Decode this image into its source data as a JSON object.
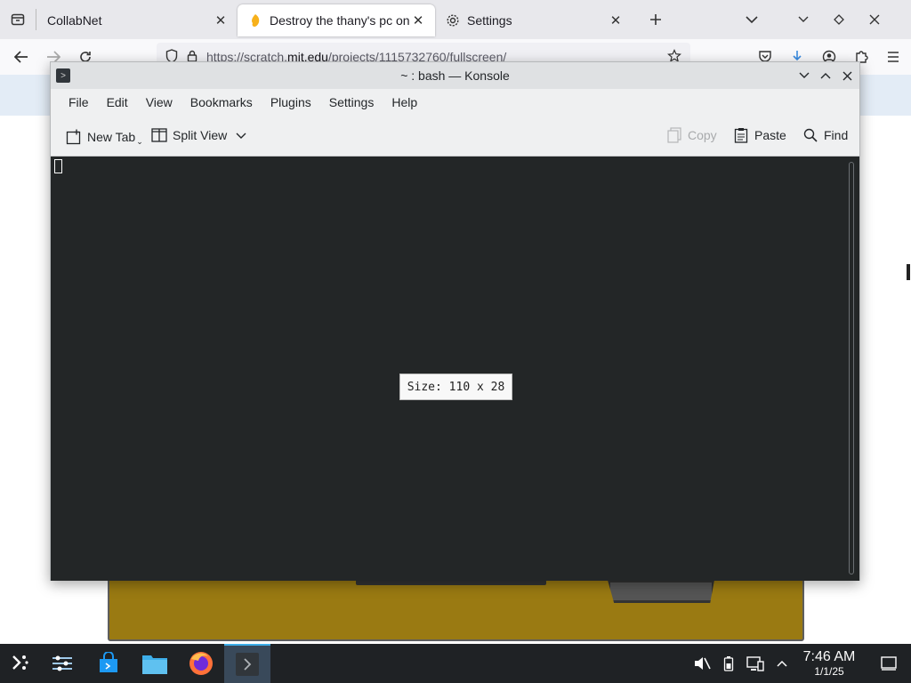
{
  "browser": {
    "tabs": [
      {
        "label": "CollabNet",
        "active": false
      },
      {
        "label": "Destroy the thany's pc on :",
        "active": true
      },
      {
        "label": "Settings",
        "active": false
      }
    ],
    "url_prefix": "https://scratch.",
    "url_domain": "mit.edu",
    "url_suffix": "/projects/1115732760/fullscreen/"
  },
  "konsole": {
    "title": "~ : bash — Konsole",
    "menu": [
      "File",
      "Edit",
      "View",
      "Bookmarks",
      "Plugins",
      "Settings",
      "Help"
    ],
    "toolbar": {
      "new_tab": "New Tab",
      "split_view": "Split View",
      "copy": "Copy",
      "paste": "Paste",
      "find": "Find"
    },
    "size_tooltip": "Size: 110 x 28"
  },
  "taskbar": {
    "time": "7:46 AM",
    "date": "1/1/25"
  },
  "colors": {
    "terminal_bg": "#232627",
    "taskbar_bg": "#1f2225",
    "accent": "#3daee9",
    "stage_fill": "#9a7a12"
  }
}
